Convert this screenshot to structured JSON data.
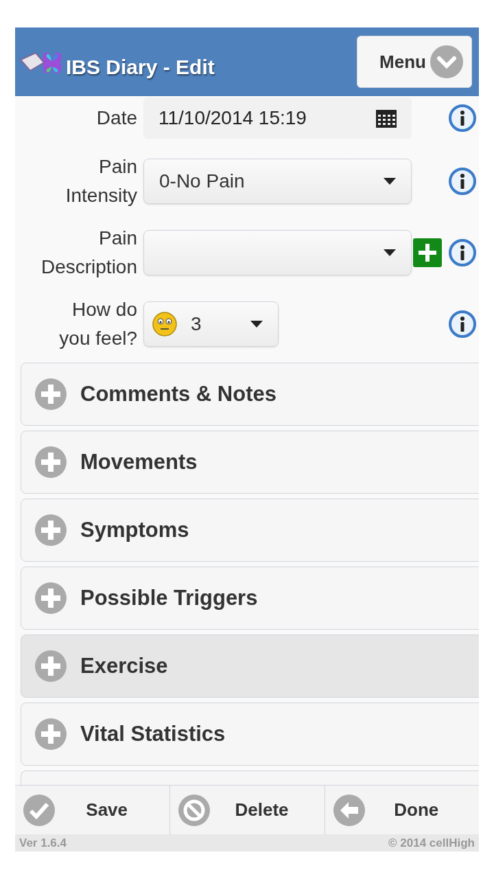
{
  "header": {
    "title": "IBS Diary - Edit",
    "menu_button": "Menu"
  },
  "fields": [
    {
      "kind": "date",
      "label_lines": [
        "Date"
      ],
      "value": "11/10/2014 15:19",
      "add_button": false
    },
    {
      "kind": "select",
      "label_lines": [
        "Pain",
        "Intensity"
      ],
      "value": "0-No Pain",
      "add_button": false
    },
    {
      "kind": "select",
      "label_lines": [
        "Pain",
        "Description"
      ],
      "add_button": true
    },
    {
      "kind": "mood",
      "label_lines": [
        "How do",
        "you feel?"
      ],
      "value": "3",
      "add_button": false
    }
  ],
  "sections": [
    {
      "title": "Comments & Notes",
      "highlighted": false
    },
    {
      "title": "Movements",
      "highlighted": false
    },
    {
      "title": "Symptoms",
      "highlighted": false
    },
    {
      "title": "Possible Triggers",
      "highlighted": false
    },
    {
      "title": "Exercise",
      "highlighted": true
    },
    {
      "title": "Vital Statistics",
      "highlighted": false
    }
  ],
  "footer_buttons": [
    {
      "kind": "save",
      "label": "Save"
    },
    {
      "kind": "delete",
      "label": "Delete"
    },
    {
      "kind": "done",
      "label": "Done"
    }
  ],
  "status_bar": {
    "version": "Ver 1.6.4",
    "copyright": "© 2014 cellHigh"
  }
}
